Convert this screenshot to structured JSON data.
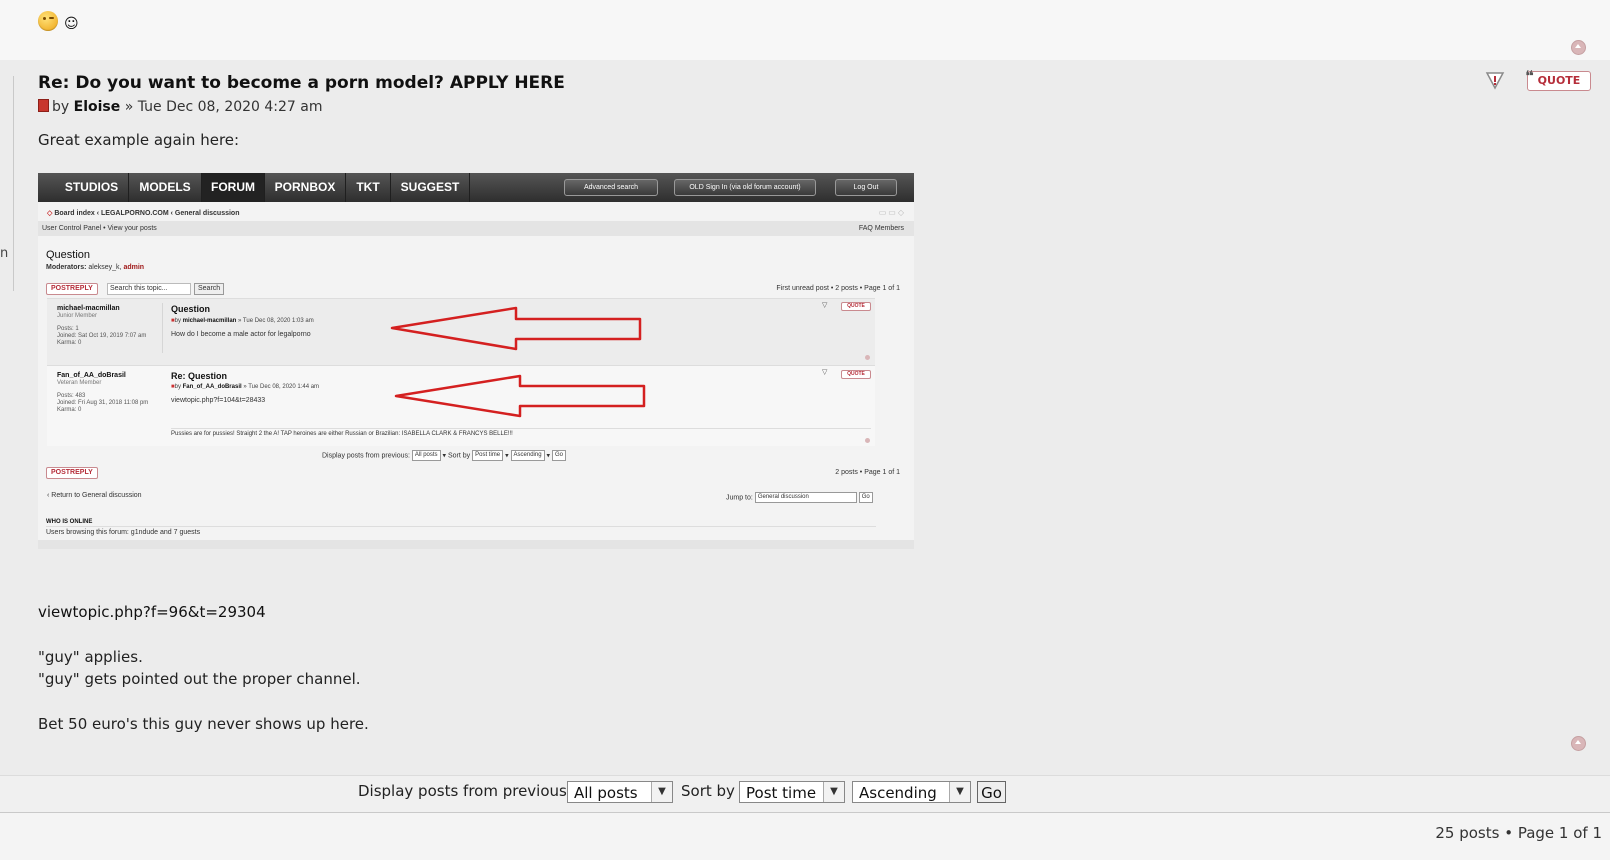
{
  "prev_post": {
    "emoji_small": "☺"
  },
  "post": {
    "title": "Re: Do you want to become a porn model? APPLY HERE",
    "meta_by": "by",
    "author": "Eloise",
    "meta_date": "» Tue Dec 08, 2020 4:27 am",
    "intro": "Great example again here:",
    "quote_label": "QUOTE",
    "left_fragment": "n",
    "link": "viewtopic.php?f=96&t=29304",
    "lines": [
      "\"guy\" applies.",
      "\"guy\" gets pointed out the proper channel.",
      "Bet 50 euro's this guy never shows up here."
    ]
  },
  "embedded": {
    "nav_tabs": [
      "STUDIOS",
      "MODELS",
      "FORUM",
      "PORNBOX",
      "TKT",
      "SUGGEST"
    ],
    "active_tab": "FORUM",
    "nav_buttons": [
      "Advanced search",
      "OLD Sign In (via old forum account)",
      "Log Out"
    ],
    "breadcrumb": "Board index ‹ LEGALPORNO.COM ‹ General discussion",
    "ucp": "User Control Panel • View your posts",
    "faq": "FAQ  Members",
    "topic_title": "Question",
    "moderators_label": "Moderators:",
    "moderators": "aleksey_k,",
    "admin": "admin",
    "postreply": "POSTREPLY",
    "search_placeholder": "Search this topic...",
    "search_btn": "Search",
    "pagination_top": "First unread post • 2 posts • Page 1 of 1",
    "posts": [
      {
        "author": "michael-macmillan",
        "rank": "Junior Member",
        "info": [
          "Posts: 1",
          "Joined: Sat Oct 19, 2019 7:07 am",
          "Karma: 0"
        ],
        "title": "Question",
        "by": "michael-macmillan",
        "date": "» Tue Dec 08, 2020 1:03 am",
        "text": "How do I become a male actor for legalporno",
        "quote": "QUOTE"
      },
      {
        "author": "Fan_of_AA_doBrasil",
        "rank": "Veteran Member",
        "info": [
          "Posts: 483",
          "Joined: Fri Aug 31, 2018 11:08 pm",
          "Karma: 0"
        ],
        "title": "Re: Question",
        "by": "Fan_of_AA_doBrasil",
        "date": "» Tue Dec 08, 2020 1:44 am",
        "text": "viewtopic.php?f=104&t=28433",
        "signature": "Pussies are for pussies! Straight 2 the A! TAP heroines are either Russian or Brazilian: ISABELLA CLARK & FRANCYS BELLE!!!",
        "quote": "QUOTE"
      }
    ],
    "display_label": "Display posts from previous:",
    "display_value": "All posts",
    "sort_label": "Sort by",
    "sort_value": "Post time",
    "order_value": "Ascending",
    "go": "Go",
    "pagination_bottom": "2 posts • Page 1 of 1",
    "return_link": "‹ Return to General discussion",
    "jump_label": "Jump to:",
    "jump_value": "General discussion",
    "who_online": "WHO IS ONLINE",
    "users_browsing": "Users browsing this forum: g1ndude and 7 guests"
  },
  "bottom": {
    "display_label": "Display posts from previous:",
    "display_value": "All posts",
    "sort_label": "Sort by",
    "sort_value": "Post time",
    "order_value": "Ascending",
    "go": "Go",
    "count": "25 posts • Page 1 of 1"
  },
  "colors": {
    "arrow": "#d42020",
    "quote": "#b52d39"
  }
}
